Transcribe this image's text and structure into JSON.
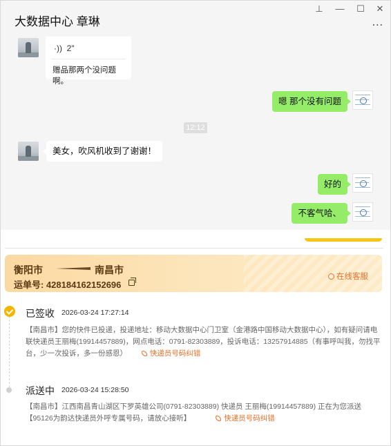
{
  "window": {
    "title": "大数据中心 章琳",
    "controls": {
      "pin": "⊥",
      "minimize": "—",
      "maximize": "☐",
      "close": "✕",
      "more": "..."
    }
  },
  "chat": {
    "voice_message": {
      "icon": "voice-icon",
      "duration": "2\"",
      "transcript": "赠品那两个没问题啊。"
    },
    "msg_right_1": "嗯 那个没有问题",
    "timestamp": "12:12",
    "msg_left_1": "美女，吹风机收到了谢谢！",
    "msg_right_2": "好的",
    "msg_right_3": "不客气哈、"
  },
  "shipment": {
    "from_city": "衡阳市",
    "to_city": "南昌市",
    "waybill_label": "运单号: 428184162152696",
    "online_service": "在线客服"
  },
  "timeline": [
    {
      "status": "已签收",
      "time": "2026-03-24 17:27:14",
      "detail": "【南昌市】您的快件已投递，投递地址：移动大数据中心门卫室（金港路中国移动大数据中心），如有疑问请电联快递员王丽梅(19914457889)，网点电话：0791-82303889，投诉电话：13257914885（有事呼叫我，勿找平台，少一次投诉，多一份感恩）",
      "fix_link": "快递员号码纠错"
    },
    {
      "status": "派送中",
      "time": "2026-03-24 15:28:50",
      "detail_line1": "【南昌市】江西南昌青山湖区下罗英雄公司(0791-82303889) 快递员 王丽梅(19914457889) 正在为您派送",
      "detail_line2": "【95126为韵达快递员外呼专属号码，请放心接听】",
      "fix_link": "快递员号码纠错"
    }
  ],
  "colors": {
    "bubble_green": "#95ec69",
    "accent_orange": "#e8702a",
    "signed_yellow": "#f5b400"
  }
}
